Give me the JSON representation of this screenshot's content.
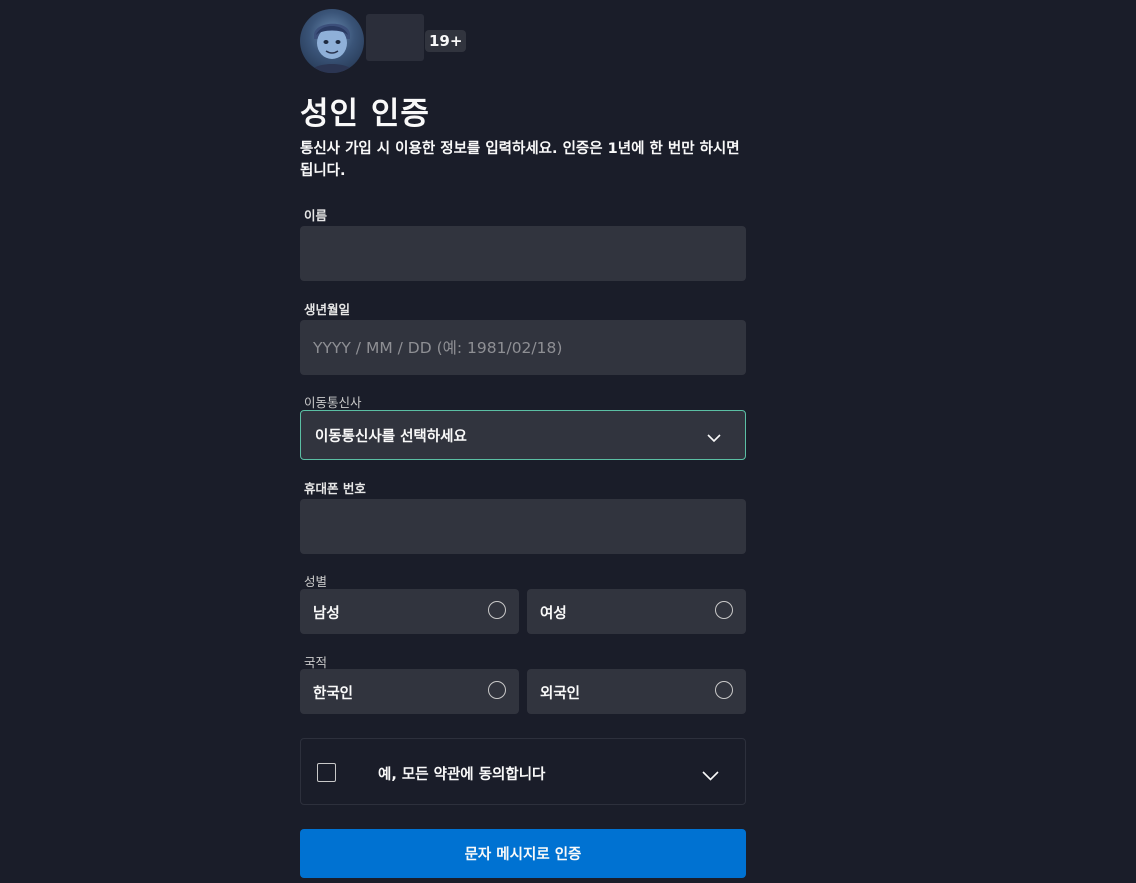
{
  "profile": {
    "age_badge": "19+",
    "avatar_icon": "avatar-character-icon"
  },
  "title": "성인 인증",
  "subtitle": "통신사 가입 시 이용한 정보를 입력하세요. 인증은 1년에 한 번만 하시면 됩니다.",
  "form": {
    "name": {
      "label": "이름",
      "value": "",
      "placeholder": ""
    },
    "birthdate": {
      "label": "생년월일",
      "value": "",
      "placeholder": "YYYY / MM / DD (예: 1981/02/18)"
    },
    "carrier": {
      "label": "이동통신사",
      "value": "이동통신사를 선택하세요",
      "icon": "chevron-down-icon"
    },
    "phone": {
      "label": "휴대폰 번호",
      "value": "",
      "placeholder": ""
    },
    "gender": {
      "label": "성별",
      "options": [
        "남성",
        "여성"
      ]
    },
    "nationality": {
      "label": "국적",
      "options": [
        "한국인",
        "외국인"
      ]
    },
    "terms": {
      "label": "예, 모든 약관에 동의합니다",
      "checked": false,
      "icon": "chevron-down-icon"
    }
  },
  "submit_label": "문자 메시지로 인증",
  "colors": {
    "background": "#1a1d29",
    "field_bg": "#31343e",
    "focus_border": "#5bbfa4",
    "primary_button": "#0072d2"
  }
}
